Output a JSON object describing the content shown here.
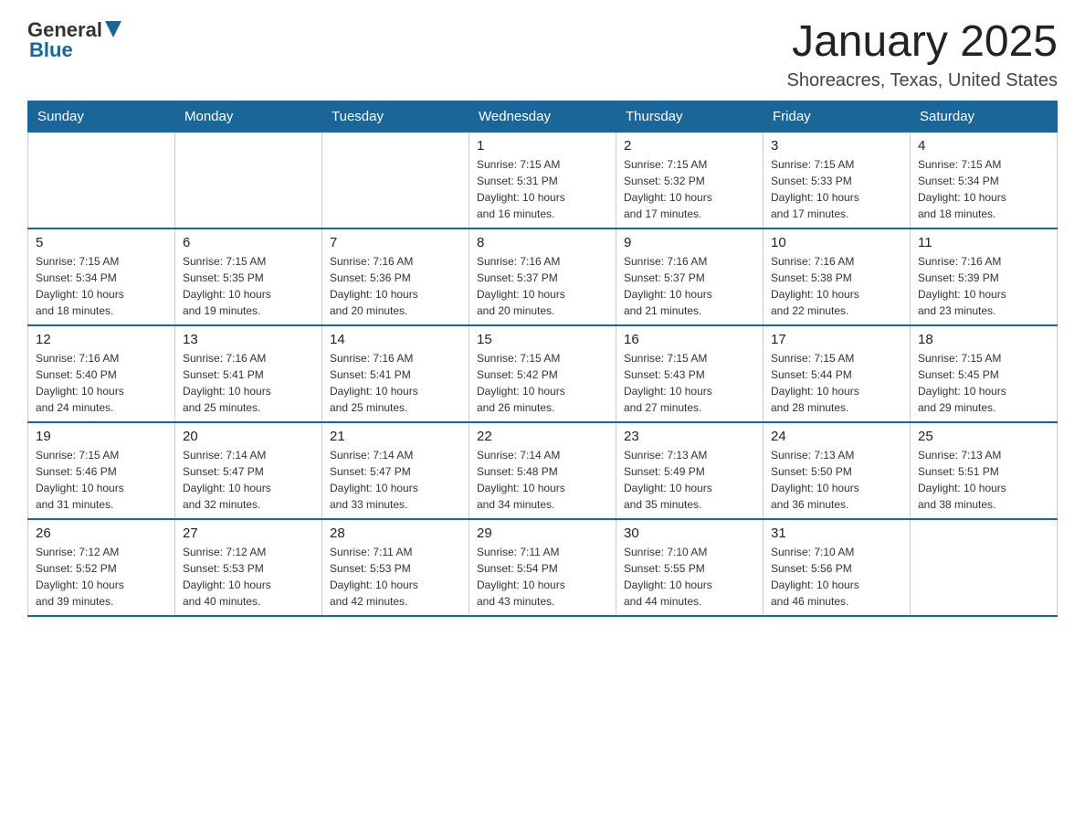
{
  "header": {
    "logo": {
      "general": "General",
      "blue": "Blue"
    },
    "title": "January 2025",
    "subtitle": "Shoreacres, Texas, United States"
  },
  "calendar": {
    "days_of_week": [
      "Sunday",
      "Monday",
      "Tuesday",
      "Wednesday",
      "Thursday",
      "Friday",
      "Saturday"
    ],
    "weeks": [
      [
        {
          "day": "",
          "info": ""
        },
        {
          "day": "",
          "info": ""
        },
        {
          "day": "",
          "info": ""
        },
        {
          "day": "1",
          "info": "Sunrise: 7:15 AM\nSunset: 5:31 PM\nDaylight: 10 hours\nand 16 minutes."
        },
        {
          "day": "2",
          "info": "Sunrise: 7:15 AM\nSunset: 5:32 PM\nDaylight: 10 hours\nand 17 minutes."
        },
        {
          "day": "3",
          "info": "Sunrise: 7:15 AM\nSunset: 5:33 PM\nDaylight: 10 hours\nand 17 minutes."
        },
        {
          "day": "4",
          "info": "Sunrise: 7:15 AM\nSunset: 5:34 PM\nDaylight: 10 hours\nand 18 minutes."
        }
      ],
      [
        {
          "day": "5",
          "info": "Sunrise: 7:15 AM\nSunset: 5:34 PM\nDaylight: 10 hours\nand 18 minutes."
        },
        {
          "day": "6",
          "info": "Sunrise: 7:15 AM\nSunset: 5:35 PM\nDaylight: 10 hours\nand 19 minutes."
        },
        {
          "day": "7",
          "info": "Sunrise: 7:16 AM\nSunset: 5:36 PM\nDaylight: 10 hours\nand 20 minutes."
        },
        {
          "day": "8",
          "info": "Sunrise: 7:16 AM\nSunset: 5:37 PM\nDaylight: 10 hours\nand 20 minutes."
        },
        {
          "day": "9",
          "info": "Sunrise: 7:16 AM\nSunset: 5:37 PM\nDaylight: 10 hours\nand 21 minutes."
        },
        {
          "day": "10",
          "info": "Sunrise: 7:16 AM\nSunset: 5:38 PM\nDaylight: 10 hours\nand 22 minutes."
        },
        {
          "day": "11",
          "info": "Sunrise: 7:16 AM\nSunset: 5:39 PM\nDaylight: 10 hours\nand 23 minutes."
        }
      ],
      [
        {
          "day": "12",
          "info": "Sunrise: 7:16 AM\nSunset: 5:40 PM\nDaylight: 10 hours\nand 24 minutes."
        },
        {
          "day": "13",
          "info": "Sunrise: 7:16 AM\nSunset: 5:41 PM\nDaylight: 10 hours\nand 25 minutes."
        },
        {
          "day": "14",
          "info": "Sunrise: 7:16 AM\nSunset: 5:41 PM\nDaylight: 10 hours\nand 25 minutes."
        },
        {
          "day": "15",
          "info": "Sunrise: 7:15 AM\nSunset: 5:42 PM\nDaylight: 10 hours\nand 26 minutes."
        },
        {
          "day": "16",
          "info": "Sunrise: 7:15 AM\nSunset: 5:43 PM\nDaylight: 10 hours\nand 27 minutes."
        },
        {
          "day": "17",
          "info": "Sunrise: 7:15 AM\nSunset: 5:44 PM\nDaylight: 10 hours\nand 28 minutes."
        },
        {
          "day": "18",
          "info": "Sunrise: 7:15 AM\nSunset: 5:45 PM\nDaylight: 10 hours\nand 29 minutes."
        }
      ],
      [
        {
          "day": "19",
          "info": "Sunrise: 7:15 AM\nSunset: 5:46 PM\nDaylight: 10 hours\nand 31 minutes."
        },
        {
          "day": "20",
          "info": "Sunrise: 7:14 AM\nSunset: 5:47 PM\nDaylight: 10 hours\nand 32 minutes."
        },
        {
          "day": "21",
          "info": "Sunrise: 7:14 AM\nSunset: 5:47 PM\nDaylight: 10 hours\nand 33 minutes."
        },
        {
          "day": "22",
          "info": "Sunrise: 7:14 AM\nSunset: 5:48 PM\nDaylight: 10 hours\nand 34 minutes."
        },
        {
          "day": "23",
          "info": "Sunrise: 7:13 AM\nSunset: 5:49 PM\nDaylight: 10 hours\nand 35 minutes."
        },
        {
          "day": "24",
          "info": "Sunrise: 7:13 AM\nSunset: 5:50 PM\nDaylight: 10 hours\nand 36 minutes."
        },
        {
          "day": "25",
          "info": "Sunrise: 7:13 AM\nSunset: 5:51 PM\nDaylight: 10 hours\nand 38 minutes."
        }
      ],
      [
        {
          "day": "26",
          "info": "Sunrise: 7:12 AM\nSunset: 5:52 PM\nDaylight: 10 hours\nand 39 minutes."
        },
        {
          "day": "27",
          "info": "Sunrise: 7:12 AM\nSunset: 5:53 PM\nDaylight: 10 hours\nand 40 minutes."
        },
        {
          "day": "28",
          "info": "Sunrise: 7:11 AM\nSunset: 5:53 PM\nDaylight: 10 hours\nand 42 minutes."
        },
        {
          "day": "29",
          "info": "Sunrise: 7:11 AM\nSunset: 5:54 PM\nDaylight: 10 hours\nand 43 minutes."
        },
        {
          "day": "30",
          "info": "Sunrise: 7:10 AM\nSunset: 5:55 PM\nDaylight: 10 hours\nand 44 minutes."
        },
        {
          "day": "31",
          "info": "Sunrise: 7:10 AM\nSunset: 5:56 PM\nDaylight: 10 hours\nand 46 minutes."
        },
        {
          "day": "",
          "info": ""
        }
      ]
    ]
  }
}
